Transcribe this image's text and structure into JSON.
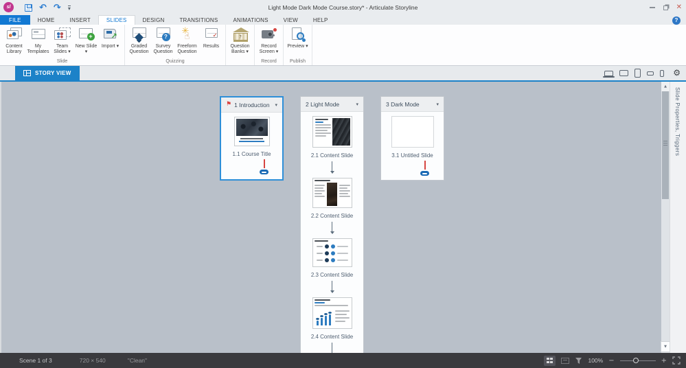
{
  "titlebar": {
    "logo_text": "sl",
    "title": "Light Mode Dark Mode Course.story* - Articulate Storyline",
    "close_glyph": "✕"
  },
  "quick_access": {
    "undo_glyph": "↶",
    "redo_glyph": "↷",
    "more_glyph": "▾"
  },
  "tabs": {
    "items": [
      {
        "label": "FILE"
      },
      {
        "label": "HOME"
      },
      {
        "label": "INSERT"
      },
      {
        "label": "SLIDES"
      },
      {
        "label": "DESIGN"
      },
      {
        "label": "TRANSITIONS"
      },
      {
        "label": "ANIMATIONS"
      },
      {
        "label": "VIEW"
      },
      {
        "label": "HELP"
      }
    ],
    "help_glyph": "?"
  },
  "ribbon": {
    "groups": [
      {
        "label": "Slide",
        "buttons": [
          {
            "label": "Content Library"
          },
          {
            "label": "My Templates"
          },
          {
            "label": "Team Slides ▾"
          },
          {
            "label": "New Slide ▾"
          },
          {
            "label": "Import ▾"
          }
        ]
      },
      {
        "label": "Quizzing",
        "buttons": [
          {
            "label": "Graded Question"
          },
          {
            "label": "Survey Question"
          },
          {
            "label": "Freeform Question"
          },
          {
            "label": "Results"
          }
        ]
      },
      {
        "label": "",
        "buttons": [
          {
            "label": "Question Banks ▾"
          }
        ]
      },
      {
        "label": "Record",
        "buttons": [
          {
            "label": "Record Screen ▾"
          }
        ]
      },
      {
        "label": "Publish",
        "buttons": [
          {
            "label": "Preview ▾"
          }
        ]
      }
    ]
  },
  "view_bar": {
    "story_view_label": "STORY VIEW",
    "gear_glyph": "⚙"
  },
  "canvas": {
    "flag_glyph": "⚑",
    "caret_glyph": "▾",
    "scenes": [
      {
        "title": "1 Introduction",
        "slides": [
          {
            "caption": "1.1 Course Title"
          }
        ]
      },
      {
        "title": "2 Light Mode",
        "slides": [
          {
            "caption": "2.1 Content Slide"
          },
          {
            "caption": "2.2 Content Slide"
          },
          {
            "caption": "2.3 Content Slide"
          },
          {
            "caption": "2.4 Content Slide"
          }
        ]
      },
      {
        "title": "3 Dark Mode",
        "slides": [
          {
            "caption": "3.1 Untitled Slide"
          }
        ]
      }
    ]
  },
  "scrollbar": {
    "up_glyph": "▲",
    "down_glyph": "▼"
  },
  "side_panel": {
    "label": "Slide Properties, Triggers"
  },
  "status_bar": {
    "scene_info": "Scene 1 of 3",
    "dimensions": "720 × 540",
    "theme": "\"Clean\"",
    "zoom_level": "100%",
    "zoom_out_glyph": "−",
    "zoom_in_glyph": "+"
  },
  "colors": {
    "accent_blue": "#1c82c8",
    "file_tab_blue": "#1279d3",
    "selection_blue": "#2e8fd8",
    "canvas_gray": "#b9c0c9",
    "statusbar_dark": "#3a3a3e",
    "flag_red": "#d9413d",
    "link_pill_blue": "#1a6ab5",
    "logo_magenta": "#c2378f"
  }
}
